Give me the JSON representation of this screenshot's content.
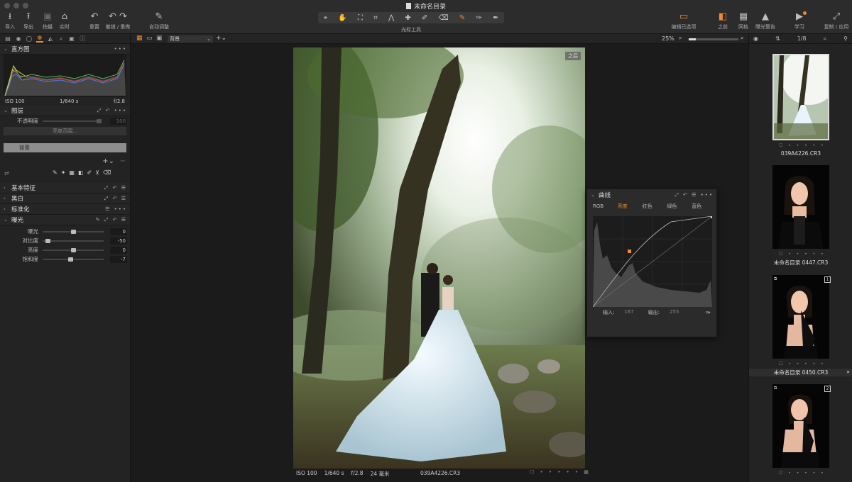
{
  "window": {
    "title": "未命名目录"
  },
  "toolbar": {
    "left": [
      {
        "id": "import",
        "icon": "⭳",
        "label": "导入"
      },
      {
        "id": "export",
        "icon": "⭱",
        "label": "导出"
      },
      {
        "id": "capture",
        "icon": "▣",
        "label": "拍摄"
      },
      {
        "id": "live",
        "icon": "⌂",
        "label": "实时"
      },
      {
        "id": "reset",
        "icon": "↶",
        "label": "重置"
      },
      {
        "id": "undo",
        "icon": "↶ ↷",
        "label": "撤销 / 重做"
      },
      {
        "id": "auto",
        "icon": "✎",
        "label": "自动调整"
      }
    ],
    "cursor_tools_label": "光标工具",
    "right": [
      {
        "id": "edit_selected",
        "icon": "▭",
        "label": "编辑已选项"
      },
      {
        "id": "before",
        "icon": "◧",
        "label": "之前"
      },
      {
        "id": "grid",
        "icon": "▦",
        "label": "网格"
      },
      {
        "id": "exposure_warning",
        "icon": "▲",
        "label": "曝光警告"
      },
      {
        "id": "learn",
        "icon": "▶",
        "label": "学习"
      },
      {
        "id": "copy_apply",
        "icon": "⤢",
        "label": "复制 / 应用"
      }
    ]
  },
  "left_panel": {
    "histogram": {
      "title": "直方图",
      "iso": "ISO 100",
      "shutter": "1/640 s",
      "aperture": "f/2.8"
    },
    "layers": {
      "title": "图层",
      "opacity_label": "不透明度",
      "opacity_value": "100",
      "luma_range": "亮度范围...",
      "layer_name": "背景"
    },
    "sections": {
      "basic": "基本特征",
      "bw": "黑白",
      "normalize": "标准化",
      "exposure": "曝光"
    },
    "exposure_rows": [
      {
        "label": "曝光",
        "value": "0",
        "pos": 0.5
      },
      {
        "label": "对比度",
        "value": "-50",
        "pos": 0.05
      },
      {
        "label": "亮度",
        "value": "0",
        "pos": 0.5
      },
      {
        "label": "饱和度",
        "value": "-7",
        "pos": 0.45
      }
    ]
  },
  "viewer": {
    "layer_select": "背景",
    "zoom": "25%",
    "photo_tag": "之后",
    "info": {
      "iso": "ISO 100",
      "shutter": "1/640 s",
      "aperture": "f/2.8",
      "focal": "24 毫米"
    },
    "filename": "039A4226.CR3"
  },
  "curve_panel": {
    "title": "曲线",
    "tabs": [
      "RGB",
      "亮度",
      "红色",
      "绿色",
      "蓝色"
    ],
    "active_tab": 1,
    "input_label": "输入:",
    "input_value": "167",
    "output_label": "输出:",
    "output_value": "255"
  },
  "browser": {
    "counter": "1/8",
    "items": [
      {
        "name": "039A4226.CR3",
        "selected": true
      },
      {
        "name": "未命名目录 0447.CR3",
        "selected": false
      },
      {
        "name": "未命名目录 0450.CR3",
        "selected": false,
        "badge": "1"
      },
      {
        "name": "",
        "selected": false,
        "badge": "2"
      }
    ]
  },
  "colors": {
    "accent": "#f08a2c",
    "panel": "#232323",
    "bg": "#1b1b1b"
  }
}
